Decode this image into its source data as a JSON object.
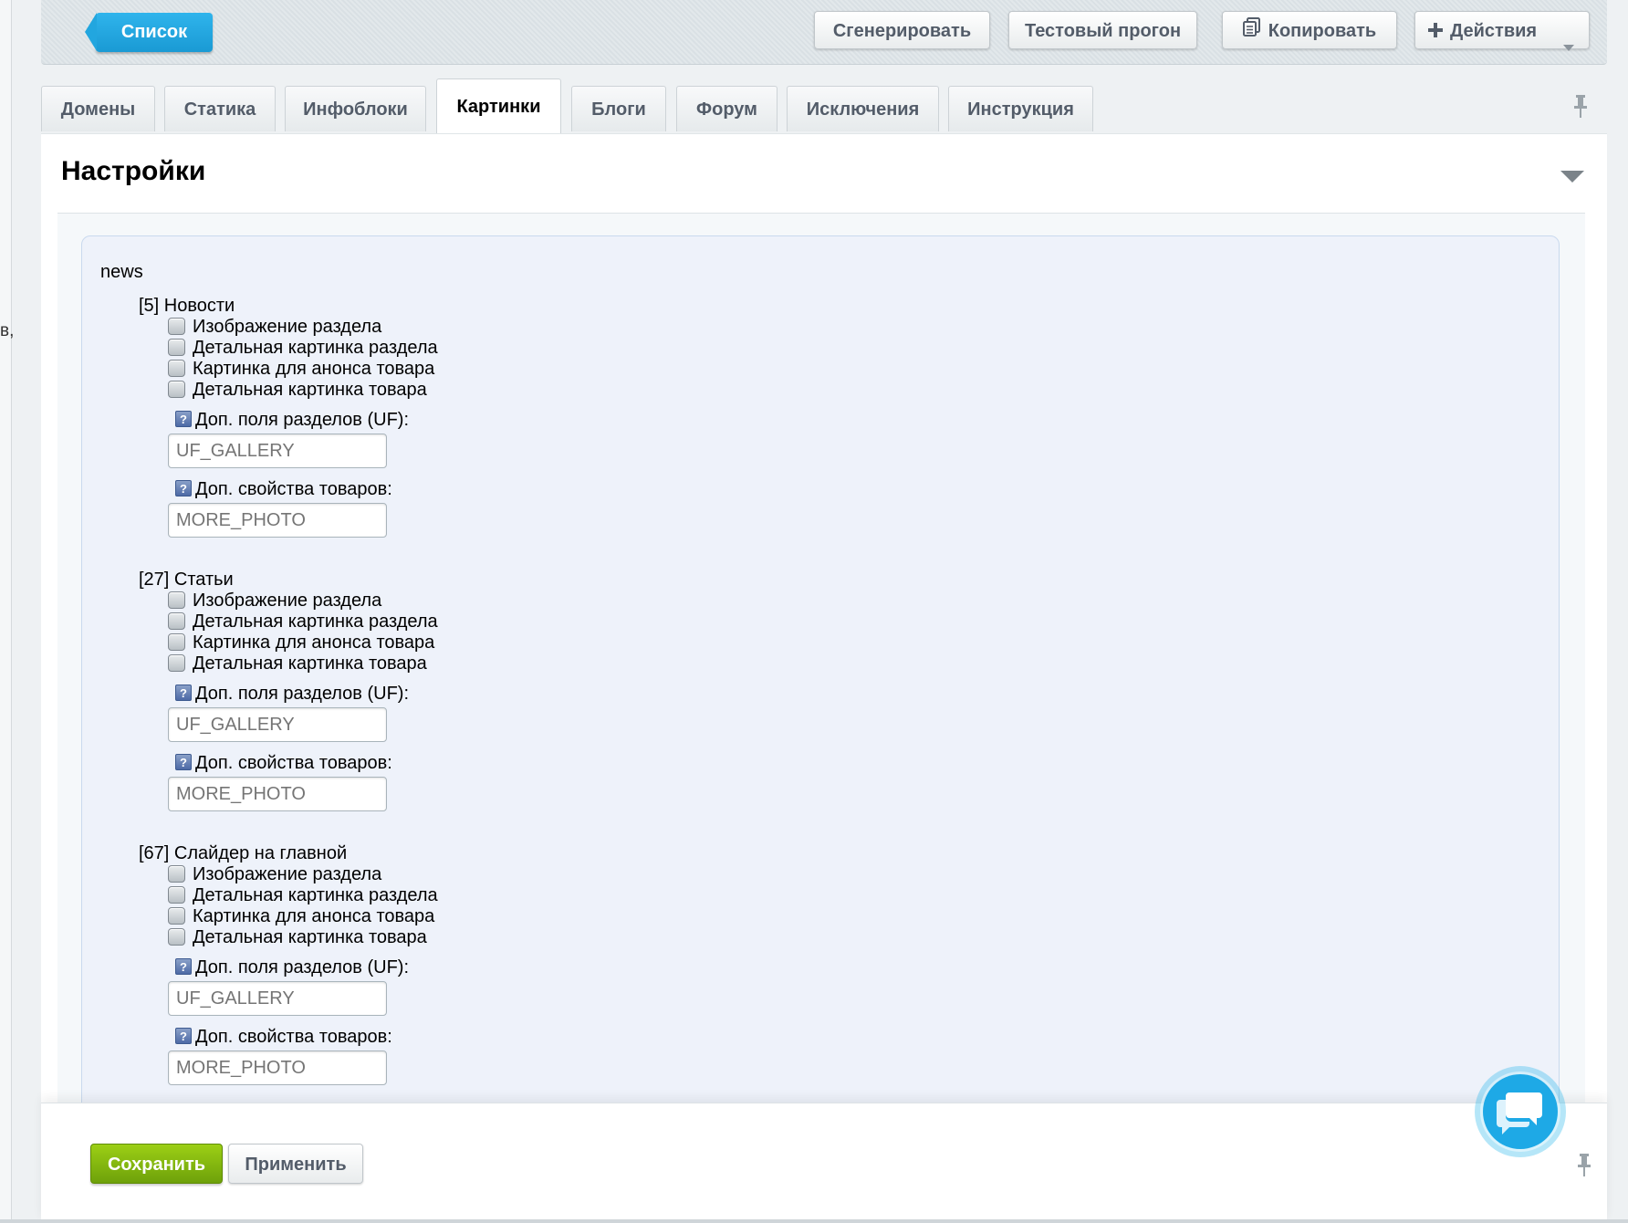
{
  "colors": {
    "accent": "#1ea9e6",
    "save": "#7fb50d",
    "panel_bg": "#eef2fa"
  },
  "left_fragment": "в,",
  "toolbar": {
    "list_label": "Список",
    "generate_label": "Сгенерировать",
    "test_run_label": "Тестовый прогон",
    "copy_label": "Копировать",
    "copy_icon": "copy-icon",
    "actions_label": "Действия",
    "actions_icon": "plus-icon"
  },
  "tabs": [
    "Домены",
    "Статика",
    "Инфоблоки",
    "Картинки",
    "Блоги",
    "Форум",
    "Исключения",
    "Инструкция"
  ],
  "active_tab": "Картинки",
  "panel": {
    "title": "Настройки",
    "group": "news",
    "sections": [
      {
        "title": "[5] Новости",
        "checkboxes": [
          "Изображение раздела",
          "Детальная картинка раздела",
          "Картинка для анонса товара",
          "Детальная картинка товара"
        ],
        "uf_label": "Доп. поля разделов (UF):",
        "uf_placeholder": "UF_GALLERY",
        "props_label": "Доп. свойства товаров:",
        "props_placeholder": "MORE_PHOTO"
      },
      {
        "title": "[27] Статьи",
        "checkboxes": [
          "Изображение раздела",
          "Детальная картинка раздела",
          "Картинка для анонса товара",
          "Детальная картинка товара"
        ],
        "uf_label": "Доп. поля разделов (UF):",
        "uf_placeholder": "UF_GALLERY",
        "props_label": "Доп. свойства товаров:",
        "props_placeholder": "MORE_PHOTO"
      },
      {
        "title": "[67] Слайдер на главной",
        "checkboxes": [
          "Изображение раздела",
          "Детальная картинка раздела",
          "Картинка для анонса товара",
          "Детальная картинка товара"
        ],
        "uf_label": "Доп. поля разделов (UF):",
        "uf_placeholder": "UF_GALLERY",
        "props_label": "Доп. свойства товаров:",
        "props_placeholder": "MORE_PHOTO"
      }
    ]
  },
  "footer": {
    "save_label": "Сохранить",
    "apply_label": "Применить"
  }
}
